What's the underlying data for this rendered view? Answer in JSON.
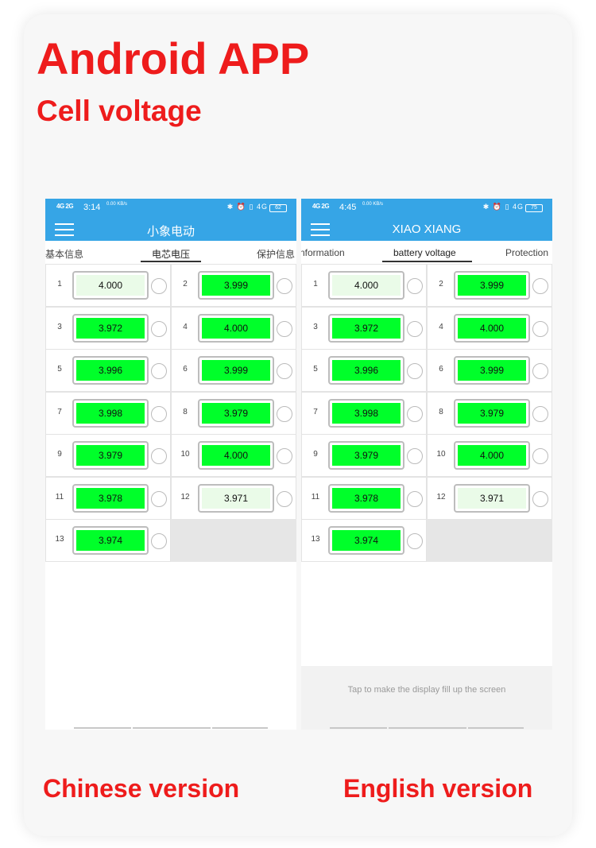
{
  "heading": "Android APP",
  "subheading": "Cell voltage",
  "captions": {
    "left": "Chinese version",
    "right": "English version"
  },
  "phones": {
    "cn": {
      "status": {
        "signal": "4G 2G",
        "time": "3:14",
        "speed": "0.00 KB/s",
        "icons": "✱ ⏰ ▯ 4G",
        "battery": "62"
      },
      "title": "小象电动",
      "tabs": [
        {
          "label": "基本信息"
        },
        {
          "label": "电芯电压",
          "active": true
        },
        {
          "label": "保护信息"
        }
      ]
    },
    "en": {
      "status": {
        "signal": "4G 2G",
        "time": "4:45",
        "speed": "0.00 KB/s",
        "icons": "✱ ⏰ ▯ 4G",
        "battery": "75"
      },
      "title": "XIAO XIANG",
      "tabs": [
        {
          "label": "nformation"
        },
        {
          "label": "battery voltage",
          "active": true
        },
        {
          "label": "Protection"
        }
      ],
      "hint": "Tap to make the display fill up the screen"
    }
  },
  "cells": [
    {
      "n": "1",
      "v": "4.000",
      "state": "low"
    },
    {
      "n": "2",
      "v": "3.999",
      "state": "normal"
    },
    {
      "n": "3",
      "v": "3.972",
      "state": "normal"
    },
    {
      "n": "4",
      "v": "4.000",
      "state": "normal"
    },
    {
      "n": "5",
      "v": "3.996",
      "state": "normal"
    },
    {
      "n": "6",
      "v": "3.999",
      "state": "normal"
    },
    {
      "n": "7",
      "v": "3.998",
      "state": "normal"
    },
    {
      "n": "8",
      "v": "3.979",
      "state": "normal"
    },
    {
      "n": "9",
      "v": "3.979",
      "state": "normal"
    },
    {
      "n": "10",
      "v": "4.000",
      "state": "normal"
    },
    {
      "n": "11",
      "v": "3.978",
      "state": "normal"
    },
    {
      "n": "12",
      "v": "3.971",
      "state": "low"
    },
    {
      "n": "13",
      "v": "3.974",
      "state": "normal"
    }
  ],
  "colors": {
    "accent": "#36a5e6",
    "cell_fill": "#00ff2a",
    "cell_fill_low": "#eafbe8",
    "caption": "#ee1c1c"
  }
}
